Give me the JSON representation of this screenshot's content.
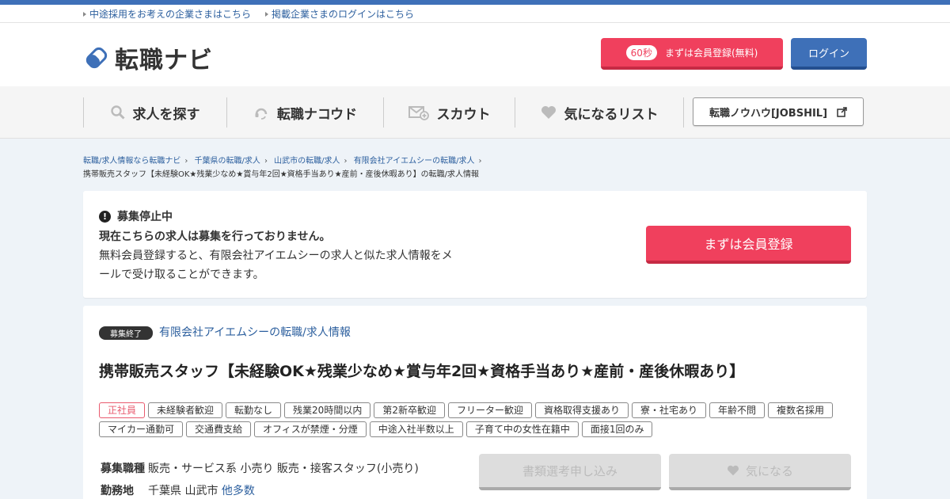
{
  "utility_links": [
    "中途採用をお考えの企業さまはこちら",
    "掲載企業さまのログインはこちら"
  ],
  "logo_text": "転職ナビ",
  "header": {
    "register_badge": "60秒",
    "register_label": "まずは会員登録(無料)",
    "login_label": "ログイン"
  },
  "nav": {
    "items": [
      "求人を探す",
      "転職ナコウド",
      "スカウト",
      "気になるリスト"
    ],
    "knowhow_label": "転職ノウハウ[JOBSHIL]"
  },
  "breadcrumb": {
    "links": [
      "転職/求人情報なら転職ナビ",
      "千葉県の転職/求人",
      "山武市の転職/求人",
      "有限会社アイエムシーの転職/求人"
    ],
    "current": "携帯販売スタッフ【未経験OK★残業少なめ★賞与年2回★資格手当あり★産前・産後休暇あり】の転職/求人情報"
  },
  "notice": {
    "title": "募集停止中",
    "headline": "現在こちらの求人は募集を行っておりません。",
    "description": "無料会員登録すると、有限会社アイエムシーの求人と似た求人情報をメールで受け取ることができます。",
    "cta_label": "まずは会員登録"
  },
  "job": {
    "status": "募集終了",
    "company_link": "有限会社アイエムシーの転職/求人情報",
    "title": "携帯販売スタッフ【未経験OK★残業少なめ★賞与年2回★資格手当あり★産前・産後休暇あり】",
    "tags": [
      "正社員",
      "未経験者歓迎",
      "転勤なし",
      "残業20時間以内",
      "第2新卒歓迎",
      "フリーター歓迎",
      "資格取得支援あり",
      "寮・社宅あり",
      "年齢不問",
      "複数名採用",
      "マイカー通勤可",
      "交通費支給",
      "オフィスが禁煙・分煙",
      "中途入社半数以上",
      "子育て中の女性在籍中",
      "面接1回のみ"
    ],
    "category_label": "募集職種",
    "category_value": "販売・サービス系 小売り 販売・接客スタッフ(小売り)",
    "location_label": "勤務地",
    "location_value": "千葉県 山武市",
    "location_more": "他多数",
    "apply_label": "書類選考申し込み",
    "fav_label": "気になる"
  },
  "colors": {
    "brand_blue": "#3e70b8",
    "cta_red": "#f0405d"
  }
}
